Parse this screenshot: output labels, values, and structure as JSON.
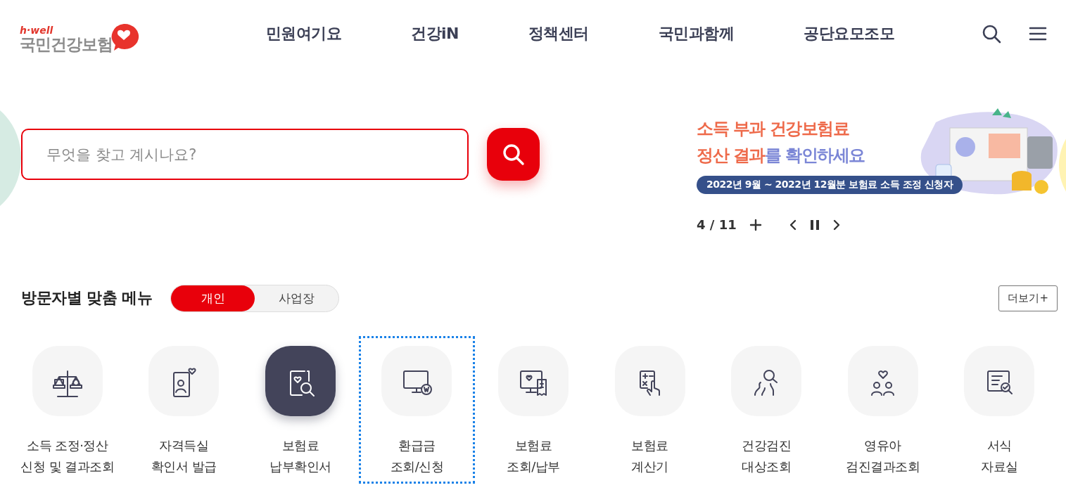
{
  "header": {
    "logo": {
      "tagline": "h·well",
      "name": "국민건강보험"
    },
    "nav": [
      "민원여기요",
      "건강iN",
      "정책센터",
      "국민과함께",
      "공단요모조모"
    ]
  },
  "search": {
    "placeholder": "무엇을 찾고 계시나요?"
  },
  "banner": {
    "line_1": [
      {
        "text": "소득 부과 건강보험료",
        "color": "#ee6a4a"
      }
    ],
    "line_2": [
      {
        "text": "정산 결과",
        "color": "#ee6a4a"
      },
      {
        "text": "를 ",
        "color": "#7b86d6"
      },
      {
        "text": "확인하세요",
        "color": "#7b86d6"
      }
    ],
    "subtitle": "2022년 9월 ~ 2022년 12월분 보험료 소득 조정 신청자",
    "current": "4",
    "separator": "/",
    "total": "11",
    "paused": false
  },
  "custom_menu": {
    "title": "방문자별 맞춤 메뉴",
    "tabs": [
      {
        "label": "개인",
        "selected": true
      },
      {
        "label": "사업장",
        "selected": false
      }
    ],
    "more": "더보기+",
    "items": [
      {
        "lines": [
          "소득 조정·정산",
          "신청 및 결과조회"
        ],
        "selected": false,
        "focused": false
      },
      {
        "lines": [
          "자격득실",
          "확인서 발급"
        ],
        "selected": false,
        "focused": false
      },
      {
        "lines": [
          "보험료",
          "납부확인서"
        ],
        "selected": true,
        "focused": false
      },
      {
        "lines": [
          "환급금",
          "조회/신청"
        ],
        "selected": false,
        "focused": true
      },
      {
        "lines": [
          "보험료",
          "조회/납부"
        ],
        "selected": false,
        "focused": false
      },
      {
        "lines": [
          "보험료",
          "계산기"
        ],
        "selected": false,
        "focused": false
      },
      {
        "lines": [
          "건강검진",
          "대상조회"
        ],
        "selected": false,
        "focused": false
      },
      {
        "lines": [
          "영유아",
          "검진결과조회"
        ],
        "selected": false,
        "focused": false
      },
      {
        "lines": [
          "서식",
          "자료실"
        ],
        "selected": false,
        "focused": false
      }
    ]
  }
}
